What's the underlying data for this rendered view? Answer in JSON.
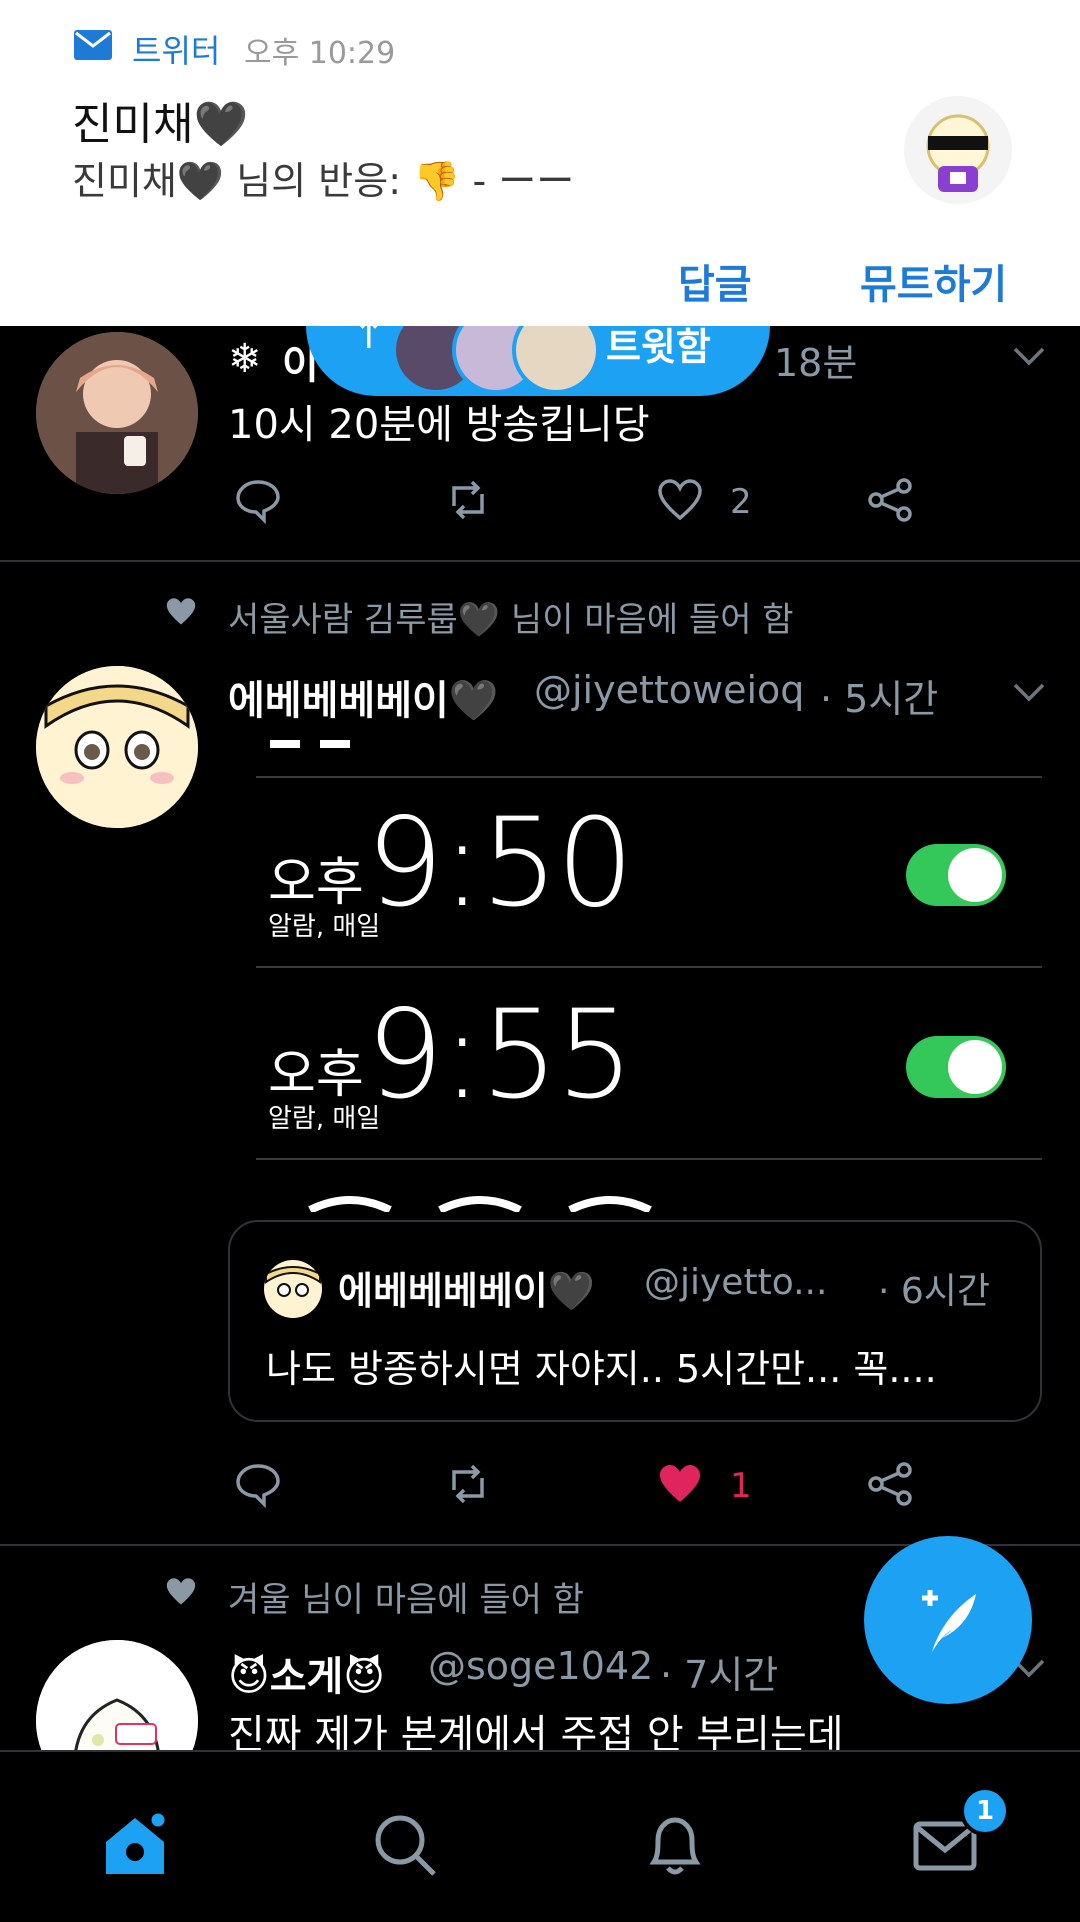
{
  "colors": {
    "accent": "#1da1f2",
    "like": "#e0245e",
    "toggle_on": "#34c759",
    "secondary_text": "#8b98a5"
  },
  "notification": {
    "app_name": "트위터",
    "time": "오후 10:29",
    "title": "진미채🖤",
    "body": "진미채🖤 님의 반응: 👎 - ーー",
    "reply_label": "답글",
    "mute_label": "뮤트하기"
  },
  "new_tweets_pill": {
    "label": "트윗함"
  },
  "tweets": [
    {
      "name": "이",
      "time": "18분",
      "text": "10시 20분에 방송킵니당",
      "like_count": "2"
    },
    {
      "context": "서울사람 김루룹🖤 님이 마음에 들어 함",
      "name": "에베베베베이🖤",
      "handle": "@jiyettoweioq",
      "time": "· 5시간",
      "alarms": [
        {
          "ampm": "오후",
          "time": "9:50",
          "sub": "알람, 매일"
        },
        {
          "ampm": "오후",
          "time": "9:55",
          "sub": "알람, 매일"
        }
      ],
      "quote": {
        "name": "에베베베베이🖤",
        "handle": "@jiyetto...",
        "time": "· 6시간",
        "text": "나도 방종하시면 자야지.. 5시간만... 꼭...."
      },
      "like_count": "1",
      "liked": true
    },
    {
      "context": "겨울 님이 마음에 들어 함",
      "name": "😈소게😈",
      "handle": "@soge1042",
      "time": "· 7시간",
      "text": "진짜 제가 본계에서 주접 안 부리는데"
    }
  ],
  "bottom_nav": {
    "items": [
      "home-icon",
      "search-icon",
      "notifications-icon",
      "messages-icon"
    ],
    "messages_badge": "1"
  }
}
